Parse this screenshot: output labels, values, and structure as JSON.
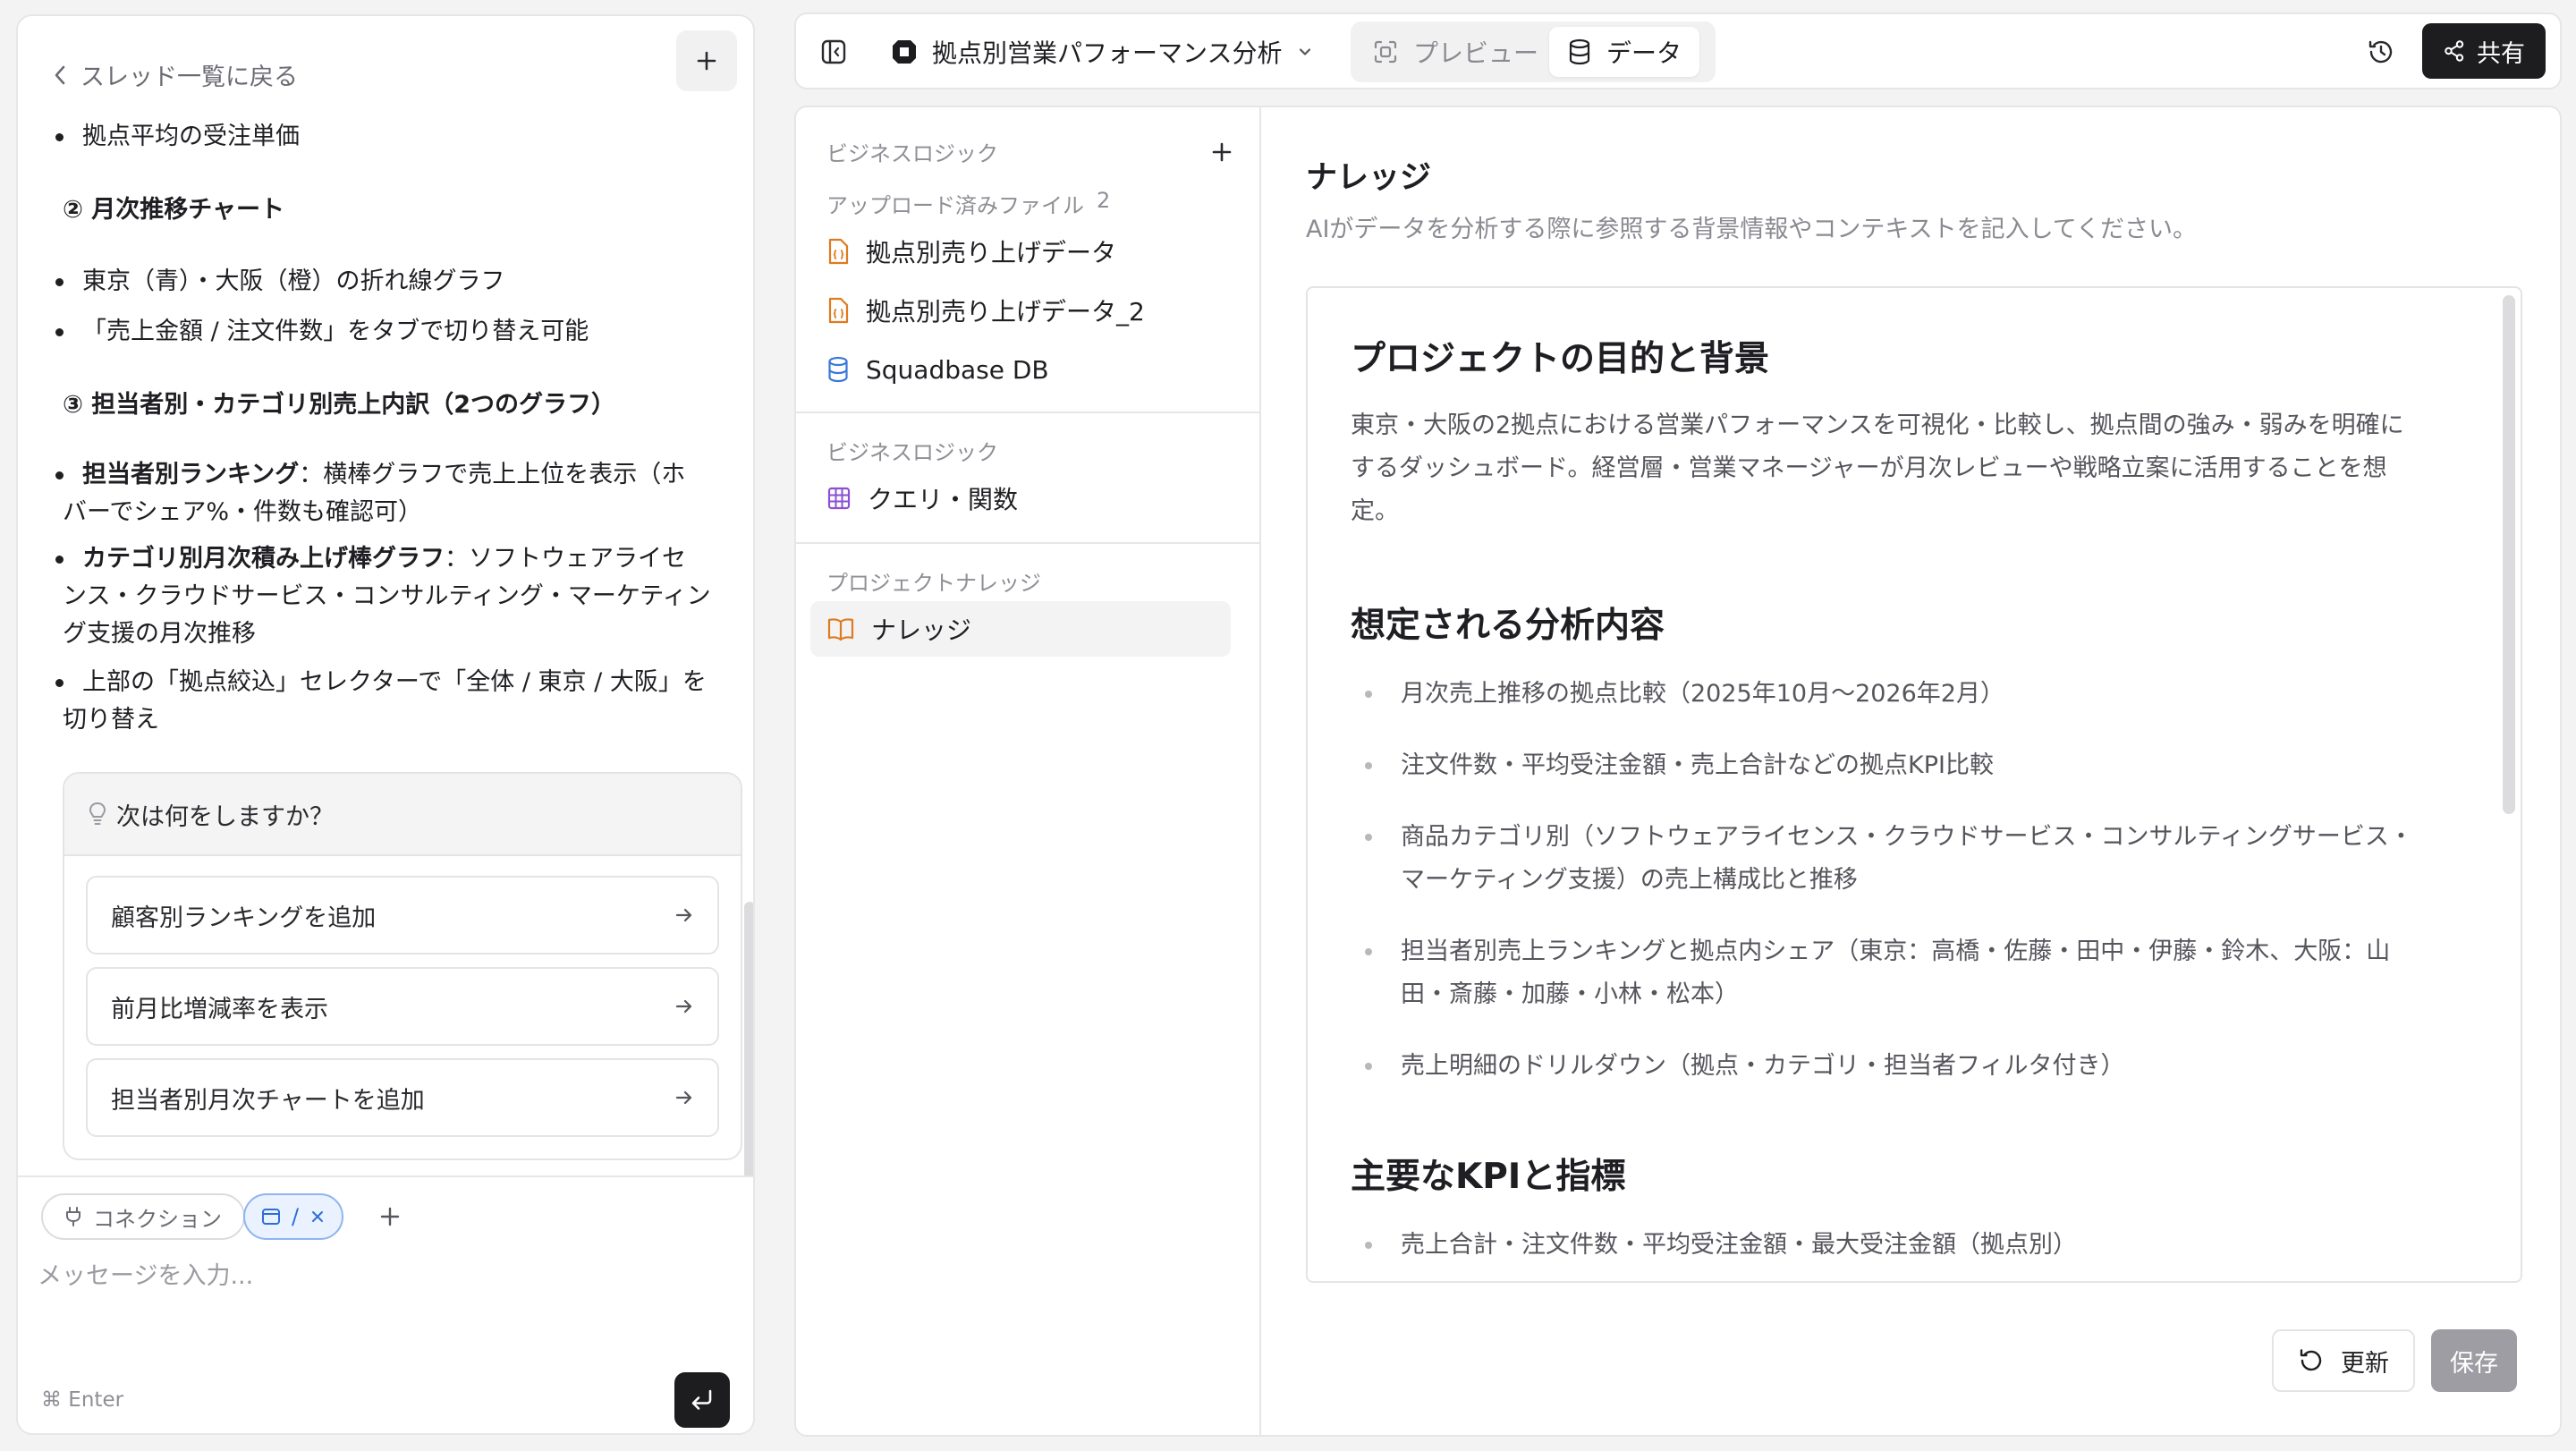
{
  "chat": {
    "back_label": "スレッド一覧に戻る",
    "messages": {
      "b_avg": "拠点平均の受注単価",
      "sec2": "② 月次推移チャート",
      "b_line": "東京（青）・大阪（橙）の折れ線グラフ",
      "b_tab": "「売上金額 / 注文件数」をタブで切り替え可能",
      "sec3": "③ 担当者別・カテゴリ別売上内訳（2つのグラフ）",
      "b_rank_bold": "担当者別ランキング",
      "b_rank_rest": "：横棒グラフで売上上位を表示（ホ",
      "b_rank_line2": "バーでシェア%・件数も確認可）",
      "b_cat_bold": "カテゴリ別月次積み上げ棒グラフ",
      "b_cat_rest": "：ソフトウェアライセ",
      "b_cat_line2": "ンス・クラウドサービス・コンサルティング・マーケティン",
      "b_cat_line3": "グ支援の月次推移",
      "b_sel_line1": "上部の「拠点絞込」セレクターで「全体 / 東京 / 大阪」を",
      "b_sel_line2": "切り替え"
    },
    "next": {
      "heading": "次は何をしますか？",
      "suggestions": [
        "顧客別ランキングを追加",
        "前月比増減率を表示",
        "担当者別月次チャートを追加"
      ]
    },
    "composer": {
      "connection_label": "コネクション",
      "context_label": "/",
      "placeholder": "メッセージを入力...",
      "hint": "⌘ Enter"
    }
  },
  "topbar": {
    "project_name": "拠点別営業パフォーマンス分析",
    "tab_preview": "プレビュー",
    "tab_data": "データ",
    "share_label": "共有"
  },
  "sidebar": {
    "section_business_logic_top": "ビジネスロジック",
    "uploaded_label": "アップロード済みファイル",
    "uploaded_count": "2",
    "files": [
      "拠点別売り上げデータ",
      "拠点別売り上げデータ_2"
    ],
    "db_label": "Squadbase DB",
    "section_business_logic": "ビジネスロジック",
    "query_label": "クエリ・関数",
    "section_project_knowledge": "プロジェクトナレッジ",
    "knowledge_label": "ナレッジ"
  },
  "knowledge": {
    "title": "ナレッジ",
    "description": "AIがデータを分析する際に参照する背景情報やコンテキストを記入してください。",
    "h1": "プロジェクトの目的と背景",
    "p1_lines": [
      "東京・大阪の2拠点における営業パフォーマンスを可視化・比較し、拠点間の強み・弱みを明確に",
      "するダッシュボード。経営層・営業マネージャーが月次レビューや戦略立案に活用することを想",
      "定。"
    ],
    "h2": "想定される分析内容",
    "items": [
      [
        "月次売上推移の拠点比較（2025年10月〜2026年2月）"
      ],
      [
        "注文件数・平均受注金額・売上合計などの拠点KPI比較"
      ],
      [
        "商品カテゴリ別（ソフトウェアライセンス・クラウドサービス・コンサルティングサービス・",
        "マーケティング支援）の売上構成比と推移"
      ],
      [
        "担当者別売上ランキングと拠点内シェア（東京：高橋・佐藤・田中・伊藤・鈴木、大阪：山",
        "田・斎藤・加藤・小林・松本）"
      ],
      [
        "売上明細のドリルダウン（拠点・カテゴリ・担当者フィルタ付き）"
      ]
    ],
    "h3": "主要なKPIと指標",
    "kpi_item": "売上合計・注文件数・平均受注金額・最大受注金額（拠点別）",
    "refresh_label": "更新",
    "save_label": "保存"
  }
}
